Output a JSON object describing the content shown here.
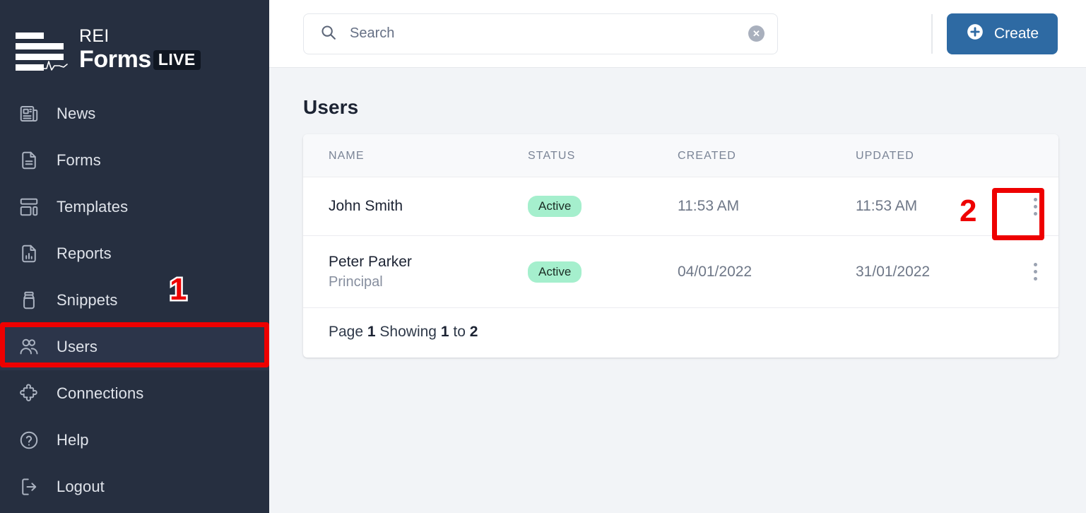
{
  "brand": {
    "rei": "REI",
    "forms": "Forms",
    "live": "LIVE"
  },
  "sidebar": {
    "items": [
      {
        "label": "News",
        "icon": "newspaper-icon",
        "active": false
      },
      {
        "label": "Forms",
        "icon": "document-icon",
        "active": false
      },
      {
        "label": "Templates",
        "icon": "layout-icon",
        "active": false
      },
      {
        "label": "Reports",
        "icon": "chart-doc-icon",
        "active": false
      },
      {
        "label": "Snippets",
        "icon": "jar-icon",
        "active": false
      },
      {
        "label": "Users",
        "icon": "users-icon",
        "active": true
      },
      {
        "label": "Connections",
        "icon": "puzzle-icon",
        "active": false
      },
      {
        "label": "Help",
        "icon": "question-icon",
        "active": false
      },
      {
        "label": "Logout",
        "icon": "logout-icon",
        "active": false
      }
    ]
  },
  "topbar": {
    "search": {
      "value": "",
      "placeholder": "Search"
    },
    "clear_label": "✕",
    "create_label": "Create"
  },
  "page": {
    "title": "Users"
  },
  "table": {
    "columns": [
      "NAME",
      "STATUS",
      "CREATED",
      "UPDATED"
    ],
    "rows": [
      {
        "name": "John Smith",
        "subtitle": "",
        "status": "Active",
        "created": "11:53 AM",
        "updated": "11:53 AM"
      },
      {
        "name": "Peter Parker",
        "subtitle": "Principal",
        "status": "Active",
        "created": "04/01/2022",
        "updated": "31/01/2022"
      }
    ]
  },
  "pagination": {
    "page_word": "Page",
    "page_number": "1",
    "showing_word": "Showing",
    "range_from": "1",
    "to_word": "to",
    "range_to": "2"
  },
  "annotations": {
    "marker_1": "1",
    "marker_2": "2",
    "color": "#ee0000"
  },
  "colors": {
    "sidebar_bg": "#262f40",
    "content_bg": "#f2f4f7",
    "accent_blue": "#2e6aa3",
    "badge_green": "#a5efcd",
    "annotation_red": "#ee0000"
  }
}
